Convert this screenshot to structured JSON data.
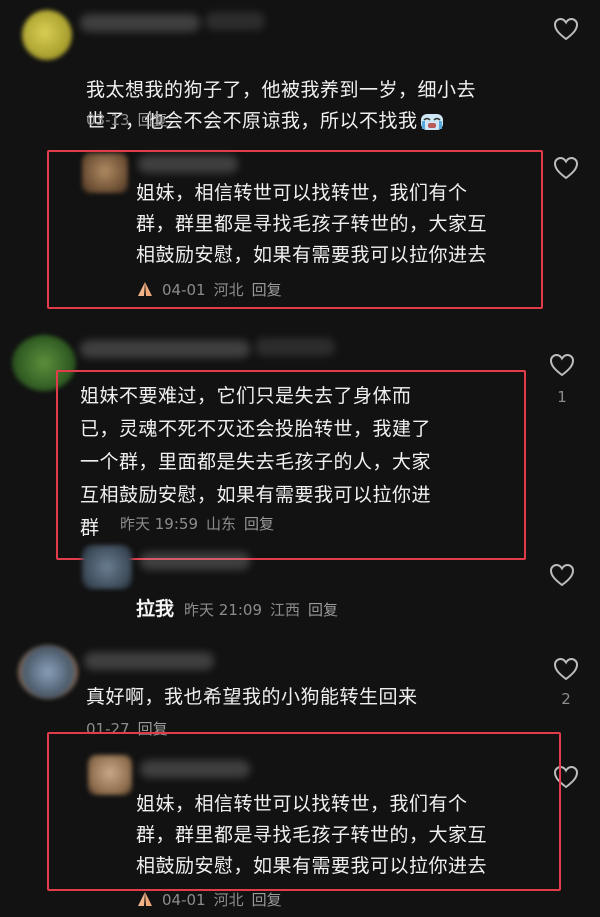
{
  "comments": [
    {
      "text": "我太想我的狗子了，他被我养到一岁，细小去\n世了，他会不会不原谅我，所以不找我",
      "date": "03-13",
      "reply_label": "回复",
      "avatar_color": "#c9c24a"
    },
    {
      "text": "姐妹，相信转世可以找转世，我们有个\n群，群里都是寻找毛孩子转世的，大家互\n相鼓励安慰，如果有需要我可以拉你进去",
      "date": "04-01",
      "location": "河北",
      "reply_label": "回复",
      "avatar_color": "#8a6a4a"
    },
    {
      "text": "姐妹不要难过，它们只是失去了身体而\n已，灵魂不死不灭还会投胎转世，我建了\n一个群，里面都是失去毛孩子的人，大家\n互相鼓励安慰，如果有需要我可以拉你进\n群",
      "date": "昨天 19:59",
      "location": "山东",
      "reply_label": "回复",
      "like_count": "1",
      "avatar_color": "#4a7a3a"
    },
    {
      "text": "拉我",
      "date": "昨天 21:09",
      "location": "江西",
      "reply_label": "回复",
      "avatar_color": "#5a6a7a"
    },
    {
      "text": "真好啊，我也希望我的小狗能转生回来",
      "date": "01-27",
      "reply_label": "回复",
      "like_count": "2",
      "avatar_color": "#6a7a8a"
    },
    {
      "text": "姐妹，相信转世可以找转世，我们有个\n群，群里都是寻找毛孩子转世的，大家互\n相鼓励安慰，如果有需要我可以拉你进去",
      "date": "04-01",
      "location": "河北",
      "reply_label": "回复",
      "avatar_color": "#9a7a5a"
    }
  ],
  "icons": {
    "like": "heart-outline-icon",
    "prayer": "pray-hands-icon",
    "crying": "crying-face-icon"
  },
  "colors": {
    "highlight_box": "#e23b4a",
    "background": "#121212"
  }
}
